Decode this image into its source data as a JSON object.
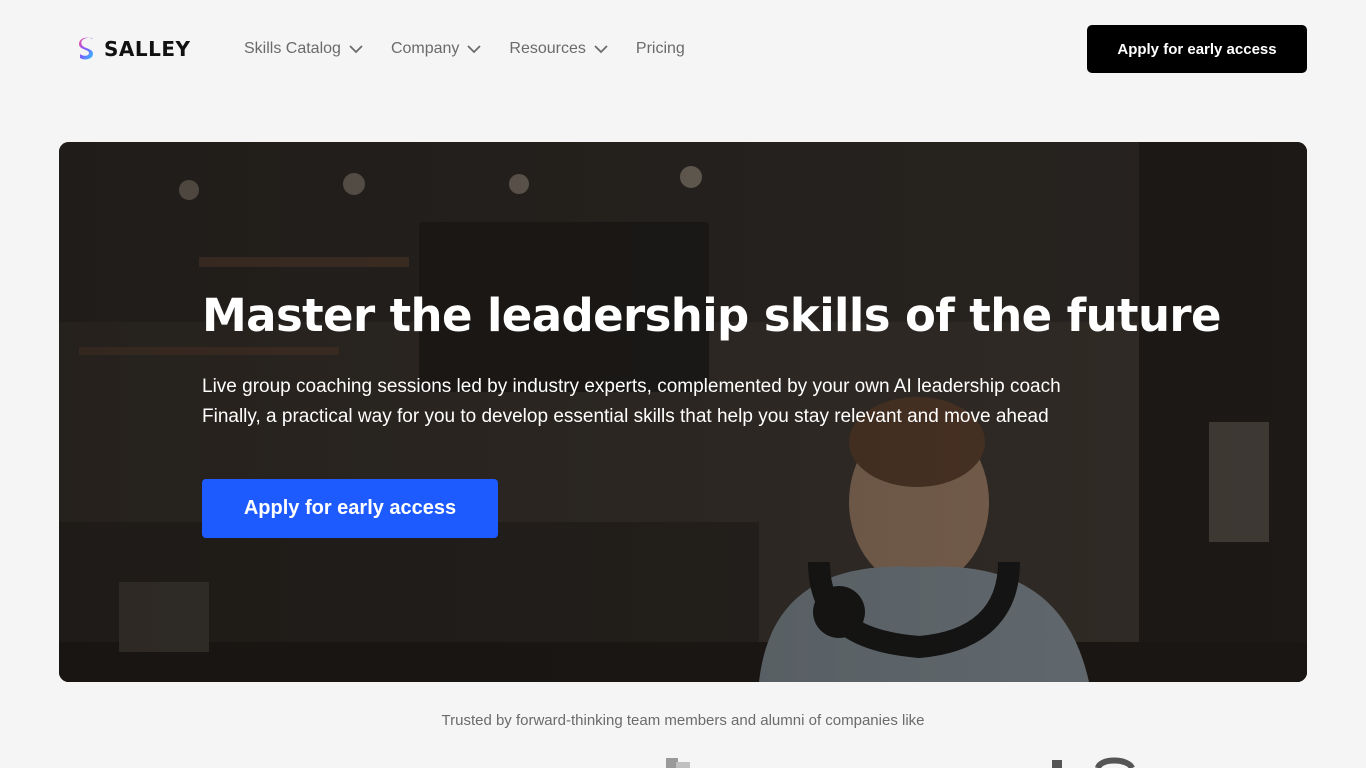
{
  "brand": {
    "name": "SALLEY",
    "mark_colors": [
      "#ff4fa3",
      "#7b5cff",
      "#2ec7ff"
    ]
  },
  "nav": {
    "items": [
      {
        "label": "Skills Catalog",
        "has_dropdown": true
      },
      {
        "label": "Company",
        "has_dropdown": true
      },
      {
        "label": "Resources",
        "has_dropdown": true
      },
      {
        "label": "Pricing",
        "has_dropdown": false
      }
    ],
    "cta_label": "Apply for early access"
  },
  "hero": {
    "title": "Master the leadership skills of the future",
    "subtitle_line1": "Live group coaching sessions led by industry experts, complemented by your own AI leadership coach",
    "subtitle_line2": "Finally, a practical way for you to develop essential skills that help you stay relevant and move ahead",
    "cta_label": "Apply for early access",
    "background": "cafe-photo-smiling-man-headphones"
  },
  "trusted": {
    "text": "Trusted by forward-thinking team members and alumni of companies like"
  },
  "colors": {
    "page_bg": "#f5f5f5",
    "primary_blue": "#1e5bff",
    "black": "#000000",
    "muted_text": "#6b6b6b"
  }
}
